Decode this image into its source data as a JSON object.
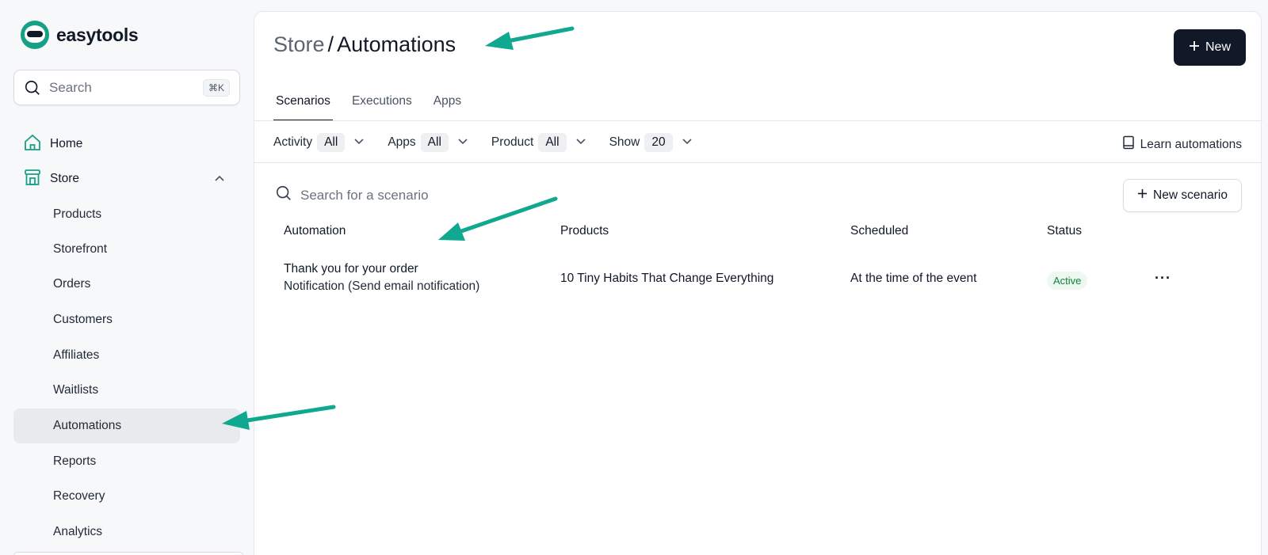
{
  "brand": {
    "name": "easytools"
  },
  "search": {
    "placeholder": "Search",
    "shortcut": "⌘K"
  },
  "sidebar": {
    "items": [
      {
        "label": "Home",
        "icon": "home-icon"
      },
      {
        "label": "Store",
        "icon": "store-icon",
        "expanded": true
      },
      {
        "label": "Products"
      },
      {
        "label": "Storefront"
      },
      {
        "label": "Orders"
      },
      {
        "label": "Customers"
      },
      {
        "label": "Affiliates"
      },
      {
        "label": "Waitlists"
      },
      {
        "label": "Automations",
        "active": true
      },
      {
        "label": "Reports"
      },
      {
        "label": "Recovery"
      },
      {
        "label": "Analytics"
      }
    ]
  },
  "header": {
    "breadcrumb_parent": "Store",
    "separator": "/",
    "title": "Automations",
    "new_label": "New"
  },
  "tabs": [
    {
      "label": "Scenarios",
      "active": true
    },
    {
      "label": "Executions"
    },
    {
      "label": "Apps"
    }
  ],
  "filters": [
    {
      "label": "Activity",
      "value": "All"
    },
    {
      "label": "Apps",
      "value": "All"
    },
    {
      "label": "Product",
      "value": "All"
    },
    {
      "label": "Show",
      "value": "20"
    }
  ],
  "learn_label": "Learn automations",
  "scenario_search": {
    "placeholder": "Search for a scenario"
  },
  "new_scenario_label": "New scenario",
  "table": {
    "columns": [
      "Automation",
      "Products",
      "Scheduled",
      "Status"
    ],
    "rows": [
      {
        "name": "Thank you for your order",
        "type": "Notification (Send email notification)",
        "product": "10 Tiny Habits That Change Everything",
        "scheduled": "At the time of the event",
        "status": "Active",
        "actions": "···"
      }
    ]
  },
  "colors": {
    "accent": "#16a085",
    "primary_button": "#111827",
    "active_badge_bg": "#ecf8f0",
    "active_badge_text": "#15803d"
  }
}
